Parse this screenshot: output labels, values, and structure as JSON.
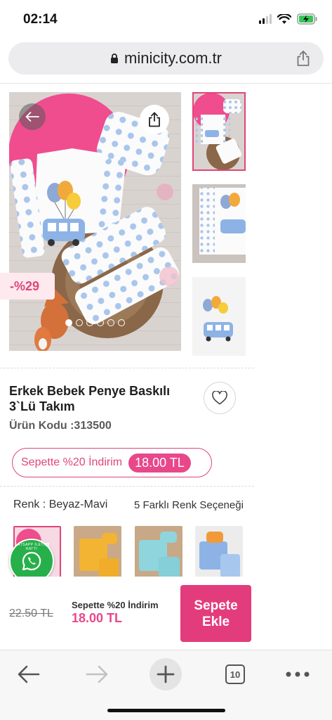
{
  "status_bar": {
    "time": "02:14"
  },
  "browser": {
    "url": "minicity.com.tr",
    "tab_count": "10"
  },
  "product": {
    "discount_badge": "-%29",
    "title": "Erkek Bebek Penye Baskılı 3`Lü Takım",
    "code": "Ürün Kodu :313500",
    "promo_text": "Sepette %20 İndirim",
    "promo_price": "18.00 TL",
    "color_label": "Renk : Beyaz-Mavi",
    "color_options_text": "5 Farklı Renk Seçeneği",
    "image_dots": 6,
    "active_dot": 0
  },
  "whatsapp": {
    "label": "WHATSAPP İLETİŞİM HATTI"
  },
  "buy_bar": {
    "old_price": "22.50 TL",
    "promo_label": "Sepette %20 İndirim",
    "promo_price": "18.00 TL",
    "add_to_cart": "Sepete Ekle"
  },
  "colors": {
    "accent": "#e33c7c",
    "whatsapp": "#27b04a"
  }
}
